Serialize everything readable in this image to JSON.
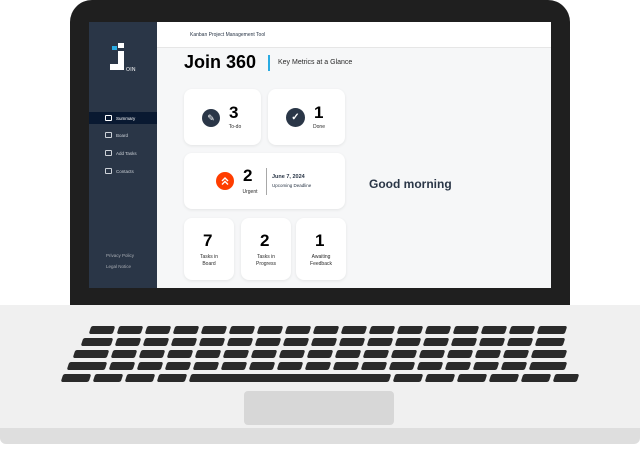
{
  "app": {
    "header_title": "Kanban Project Management Tool",
    "logo_suffix": "OIN"
  },
  "sidebar": {
    "items": [
      {
        "label": "Summary",
        "icon": "summary-icon",
        "active": true
      },
      {
        "label": "Board",
        "icon": "board-icon",
        "active": false
      },
      {
        "label": "Add Tasks",
        "icon": "add-task-icon",
        "active": false
      },
      {
        "label": "Contacts",
        "icon": "contacts-icon",
        "active": false
      }
    ],
    "privacy_policy": "Privacy Policy",
    "legal_notice": "Legal Notice"
  },
  "main": {
    "title": "Join 360",
    "subtitle": "Key Metrics at a Glance",
    "greeting": "Good morning",
    "todo": {
      "count": "3",
      "label": "To-do",
      "icon": "pencil-icon"
    },
    "done": {
      "count": "1",
      "label": "Done",
      "icon": "check-icon"
    },
    "urgent": {
      "count": "2",
      "label": "Urgent",
      "icon": "double-chevron-up-icon",
      "deadline_date": "June 7, 2024",
      "deadline_label": "Upcoming Deadline"
    },
    "stats": [
      {
        "count": "7",
        "label_line1": "Tasks in",
        "label_line2": "Board"
      },
      {
        "count": "2",
        "label_line1": "Tasks in",
        "label_line2": "Progress"
      },
      {
        "count": "1",
        "label_line1": "Awaiting",
        "label_line2": "Feedback"
      }
    ]
  },
  "colors": {
    "sidebar_bg": "#2a3647",
    "active_nav_bg": "#091931",
    "accent_blue": "#29abe2",
    "urgent_orange": "#ff3d00",
    "icon_dark": "#2a3647"
  }
}
